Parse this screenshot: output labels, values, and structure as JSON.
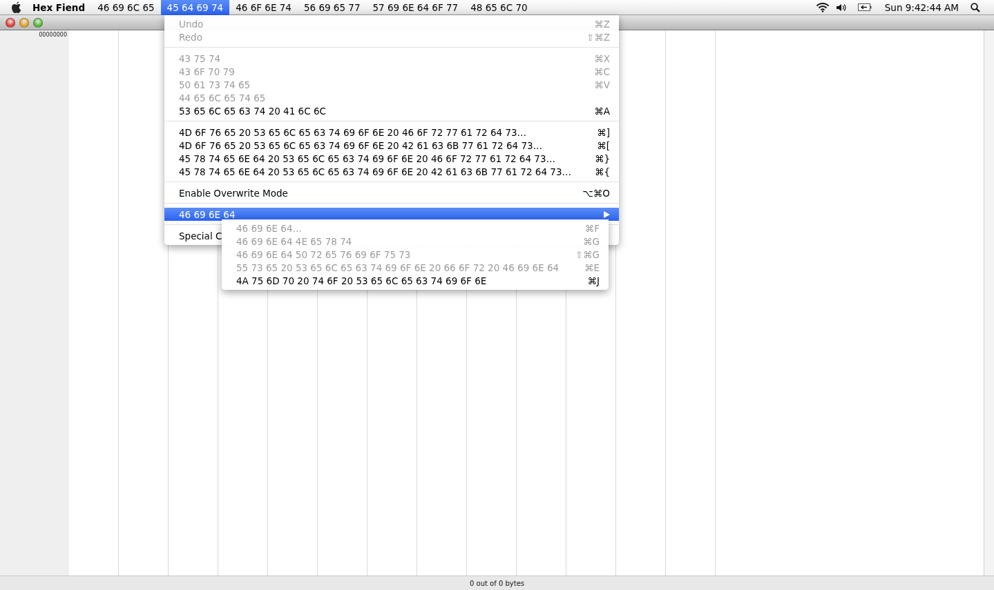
{
  "menubar": {
    "app_name": "Hex Fiend",
    "menus": [
      {
        "label": "46 69 6C 65",
        "selected": false
      },
      {
        "label": "45 64 69 74",
        "selected": true
      },
      {
        "label": "46 6F 6E 74",
        "selected": false
      },
      {
        "label": "56 69 65 77",
        "selected": false
      },
      {
        "label": "57 69 6E 64 6F 77",
        "selected": false
      },
      {
        "label": "48 65 6C 70",
        "selected": false
      }
    ],
    "clock": "Sun 9:42:44 AM"
  },
  "window": {
    "offset_label": "00000000",
    "status": "0 out of 0 bytes"
  },
  "edit_menu": [
    {
      "kind": "item",
      "label": "Undo",
      "shortcut": "⌘Z",
      "disabled": true,
      "selected": false
    },
    {
      "kind": "item",
      "label": "Redo",
      "shortcut": "⇧⌘Z",
      "disabled": true,
      "selected": false
    },
    {
      "kind": "separator"
    },
    {
      "kind": "item",
      "label": "43 75 74",
      "shortcut": "⌘X",
      "disabled": true,
      "selected": false
    },
    {
      "kind": "item",
      "label": "43 6F 70 79",
      "shortcut": "⌘C",
      "disabled": true,
      "selected": false
    },
    {
      "kind": "item",
      "label": "50 61 73 74 65",
      "shortcut": "⌘V",
      "disabled": true,
      "selected": false
    },
    {
      "kind": "item",
      "label": "44 65 6C 65 74 65",
      "disabled": true,
      "selected": false
    },
    {
      "kind": "item",
      "label": "53 65 6C 65 63 74 20 41 6C 6C",
      "shortcut": "⌘A",
      "disabled": false,
      "selected": false
    },
    {
      "kind": "separator"
    },
    {
      "kind": "item",
      "label": "4D 6F 76 65 20 53 65 6C 65 63 74 69 6F 6E 20 46 6F 72 77 61 72 64 73…",
      "shortcut": "⌘]",
      "disabled": false,
      "selected": false
    },
    {
      "kind": "item",
      "label": "4D 6F 76 65 20 53 65 6C 65 63 74 69 6F 6E 20 42 61 63 6B 77 61 72 64 73…",
      "shortcut": "⌘[",
      "disabled": false,
      "selected": false
    },
    {
      "kind": "item",
      "label": "45 78 74 65 6E 64 20 53 65 6C 65 63 74 69 6F 6E 20 46 6F 72 77 61 72 64 73…",
      "shortcut": "⌘}",
      "disabled": false,
      "selected": false
    },
    {
      "kind": "item",
      "label": "45 78 74 65 6E 64 20 53 65 6C 65 63 74 69 6F 6E 20 42 61 63 6B 77 61 72 64 73…",
      "shortcut": "⌘{",
      "disabled": false,
      "selected": false
    },
    {
      "kind": "separator"
    },
    {
      "kind": "item",
      "label": "Enable Overwrite Mode",
      "shortcut": "⌥⌘O",
      "disabled": false,
      "selected": false
    },
    {
      "kind": "separator"
    },
    {
      "kind": "submenu",
      "label": "46 69 6E 64",
      "disabled": false,
      "selected": true
    },
    {
      "kind": "separator"
    },
    {
      "kind": "item",
      "label": "Special C",
      "disabled": false,
      "selected": false
    }
  ],
  "find_submenu": [
    {
      "label": "46 69 6E 64…",
      "shortcut": "⌘F",
      "disabled": true
    },
    {
      "label": "46 69 6E 64 4E 65 78 74",
      "shortcut": "⌘G",
      "disabled": true
    },
    {
      "label": "46 69 6E 64 50 72 65 76 69 6F 75 73",
      "shortcut": "⇧⌘G",
      "disabled": true
    },
    {
      "label": "55 73 65 20 53 65 6C 65 63 74 69 6F 6E 20 66 6F 72 20 46 69 6E 64",
      "shortcut": "⌘E",
      "disabled": true
    },
    {
      "label": "4A 75 6D 70 20 74 6F 20 53 65 6C 65 63 74 69 6F 6E",
      "shortcut": "⌘J",
      "disabled": false
    }
  ]
}
